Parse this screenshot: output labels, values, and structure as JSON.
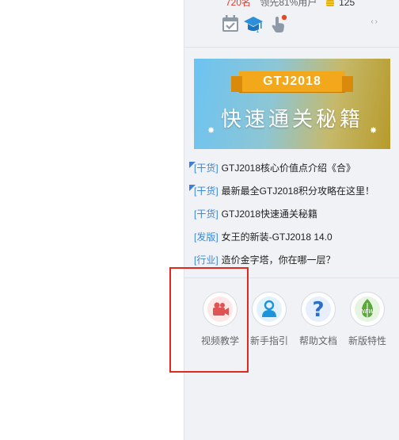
{
  "top_stats": {
    "rank": "720名",
    "percent": "领先81%用户",
    "coins": "125"
  },
  "toolbar_icons": [
    "calendar-check-icon",
    "graduation-cap-icon",
    "hand-pointer-icon"
  ],
  "nav_arrows": "‹›",
  "banner": {
    "title": "GTJ2018",
    "subtitle": "快速通关秘籍"
  },
  "news": [
    {
      "tag": "[干货]",
      "title": "GTJ2018核心价值点介绍《合》",
      "flagged": true
    },
    {
      "tag": "[干货]",
      "title": "最新最全GTJ2018积分攻略在这里！",
      "flagged": true
    },
    {
      "tag": "[干货]",
      "title": "GTJ2018快速通关秘籍",
      "flagged": false
    },
    {
      "tag": "[发版]",
      "title": "女王的新装-GTJ2018 14.0",
      "flagged": false
    },
    {
      "tag": "[行业]",
      "title": "造价金字塔，你在哪一层？",
      "flagged": false
    }
  ],
  "quick_links": [
    {
      "label": "视频教学",
      "icon": "video-camera-icon"
    },
    {
      "label": "新手指引",
      "icon": "user-guide-icon"
    },
    {
      "label": "帮助文档",
      "icon": "help-question-icon"
    },
    {
      "label": "新版特性",
      "icon": "new-leaf-icon"
    }
  ],
  "colors": {
    "accent_blue": "#3b88d6",
    "alert_red": "#e0281f",
    "banner_ribbon": "#f3a81c"
  }
}
